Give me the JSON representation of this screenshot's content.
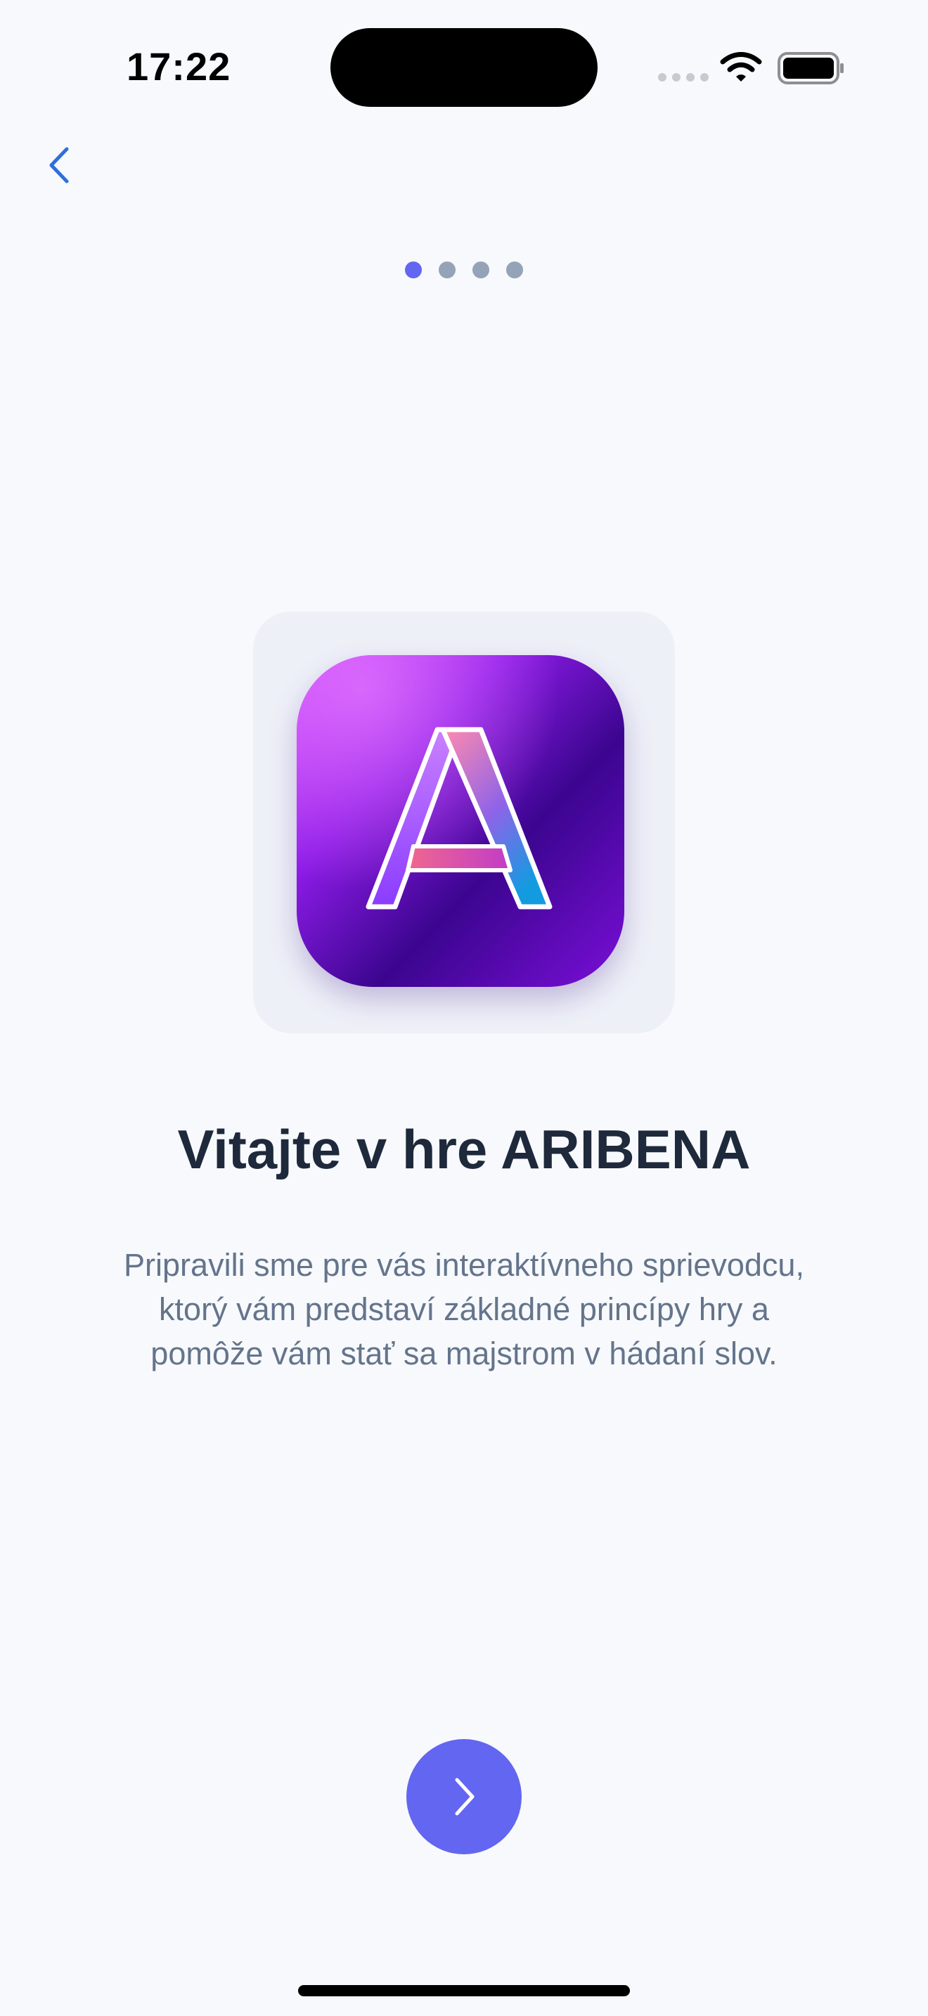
{
  "status_bar": {
    "time": "17:22"
  },
  "navigation": {
    "back_icon": "chevron-left-icon",
    "accent_color": "#2F6FDB"
  },
  "pager": {
    "total": 4,
    "current": 1,
    "active_color": "#6366F1",
    "inactive_color": "#94A3B8"
  },
  "logo": {
    "letter": "A",
    "icon": "app-logo-a-icon"
  },
  "content": {
    "title": "Vitajte v hre ARIBENA",
    "description": "Pripravili sme pre vás interaktívneho sprievodcu, ktorý vám predstaví základné princípy hry a pomôže vám stať sa majstrom v hádaní slov."
  },
  "actions": {
    "next_icon": "chevron-right-icon",
    "next_color": "#6366F1"
  }
}
